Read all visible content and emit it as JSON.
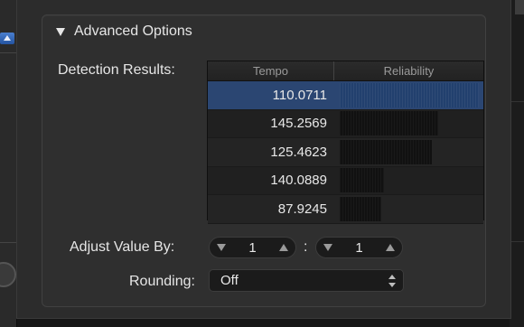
{
  "advanced": {
    "title": "Advanced Options"
  },
  "detection": {
    "label": "Detection Results:",
    "columns": {
      "tempo": "Tempo",
      "reliability": "Reliability"
    },
    "rows": [
      {
        "tempo": "110.0711",
        "reliability": 1.0
      },
      {
        "tempo": "145.2569",
        "reliability": 0.71
      },
      {
        "tempo": "125.4623",
        "reliability": 0.66
      },
      {
        "tempo": "140.0889",
        "reliability": 0.32
      },
      {
        "tempo": "87.9245",
        "reliability": 0.3
      }
    ],
    "selected_index": 0
  },
  "adjust": {
    "label": "Adjust Value By:",
    "left_value": "1",
    "separator": ":",
    "right_value": "1"
  },
  "rounding": {
    "label": "Rounding:",
    "value": "Off"
  },
  "colors": {
    "selected_row": "#2b4672",
    "panel_bg": "#2c2c2c"
  }
}
